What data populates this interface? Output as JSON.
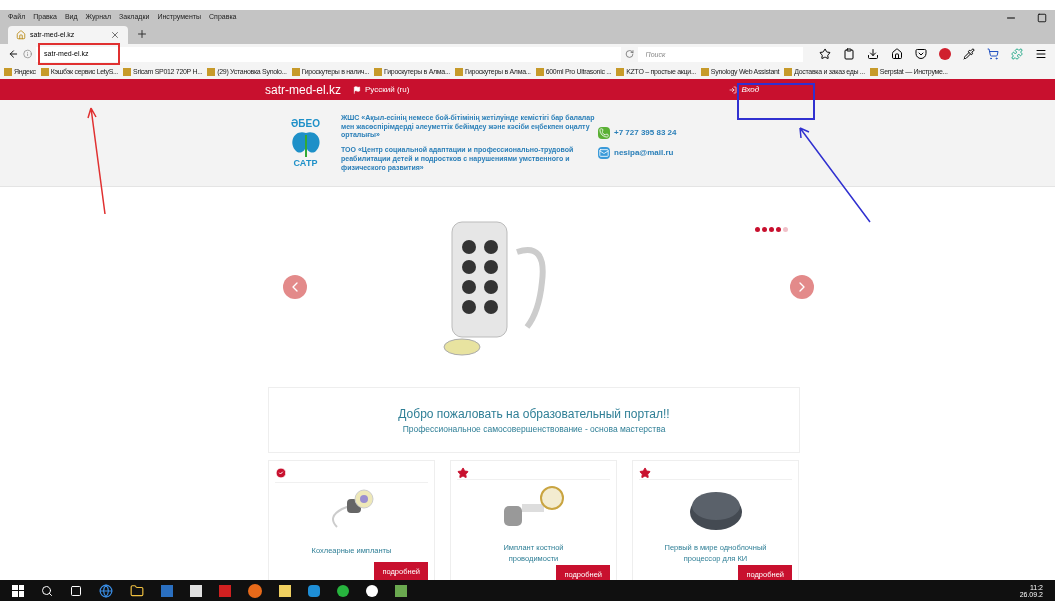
{
  "menu_bar": [
    "Файл",
    "Правка",
    "Вид",
    "Журнал",
    "Закладки",
    "Инструменты",
    "Справка"
  ],
  "tabs": [
    {
      "label": "satr-med-el.kz",
      "selected": true
    }
  ],
  "address_bar": {
    "value": "satr-med-el.kz"
  },
  "search": {
    "placeholder": "Поиск"
  },
  "bookmarks": [
    "Яндекс",
    "Кэшбэк сервис LetyS...",
    "Sricam SP012 720P H...",
    "(29) Установка Synolo...",
    "Гироскутеры в налич...",
    "Гироскутеры в Алма...",
    "Гироскутеры в Алма...",
    "600ml Pro Ultrasonic ...",
    "KZTO – простые акци...",
    "Synology Web Assistant",
    "Доставка и заказ еды ...",
    "Serpstat — Инструме..."
  ],
  "site_bar": {
    "site_name": "satr-med-el.kz",
    "language": "Русский (ru)",
    "login": "Вход"
  },
  "header": {
    "logo_top": "ӘБЕО",
    "logo_bottom": "САТР",
    "org_kz": "ЖШС «Ақыл-есінің немесе бой-бітімінің жетілуінде кемістігі бар балалар мен жасөспірімдерді әлеуметтік бейімдеу және кәсіби еңбекпен оңалту орталығы»",
    "org_ru": "ТОО «Центр социальной адаптации и профессионально-трудовой реабилитации детей и подростков с нарушениями умственного и физического развития»",
    "phone": "+7 727 395 83 24",
    "email": "nesipa@mail.ru"
  },
  "carousel": {
    "dots": [
      {
        "selected": false
      },
      {
        "selected": false
      },
      {
        "selected": false
      },
      {
        "selected": false
      },
      {
        "selected": true
      }
    ]
  },
  "welcome": {
    "title": "Добро пожаловать на образовательный портал!!",
    "subtitle": "Профессиональное самосовершенствование - основа мастерства"
  },
  "cards": [
    {
      "kind": "check",
      "title": "Кохлеарные импланты",
      "button": "подробней"
    },
    {
      "kind": "star",
      "title": "Имплант костной проводимости",
      "button": "подробней"
    },
    {
      "kind": "star",
      "title": "Первый в мире одноблочный процессор для КИ",
      "button": "подробней"
    }
  ],
  "clock": {
    "time": "11:2",
    "date": "26.09.2"
  }
}
